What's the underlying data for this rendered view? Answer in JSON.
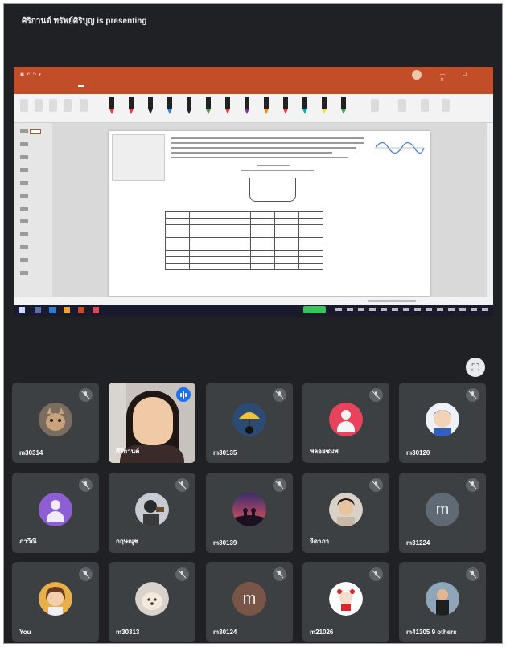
{
  "meeting": {
    "presenter_banner": "ศิริกานต์ ทรัพย์ศิริบุญ is presenting"
  },
  "shared_screen": {
    "app": "PowerPoint",
    "ribbon_tab_active": "Draw"
  },
  "colors": {
    "meet_bg": "#202124",
    "tile_bg": "#3c4043",
    "ppt_accent": "#c24d29",
    "speaking_badge": "#1a73e8"
  },
  "icons": {
    "fullscreen": "fullscreen-icon",
    "mute": "mic-off-icon",
    "speaking": "audio-wave-icon"
  },
  "participants": [
    {
      "name": "m30314",
      "avatar": "photo",
      "muted": true
    },
    {
      "name": "ศิริกานต์",
      "avatar": "video",
      "muted": false,
      "speaking": true
    },
    {
      "name": "m30135",
      "avatar": "photo",
      "muted": true
    },
    {
      "name": "พลอยชมพ",
      "avatar": "default-red",
      "muted": true
    },
    {
      "name": "m30120",
      "avatar": "photo",
      "muted": true
    },
    {
      "name": "ภาวีณี",
      "avatar": "default-purple",
      "muted": true
    },
    {
      "name": "กฤษณุช",
      "avatar": "photo",
      "muted": true
    },
    {
      "name": "m30139",
      "avatar": "photo",
      "muted": true
    },
    {
      "name": "จิดาภา",
      "avatar": "photo",
      "muted": true
    },
    {
      "name": "m31224",
      "avatar": "letter",
      "letter": "m",
      "muted": true
    },
    {
      "name": "You",
      "avatar": "photo",
      "muted": true
    },
    {
      "name": "m30313",
      "avatar": "photo",
      "muted": true
    },
    {
      "name": "m30124",
      "avatar": "letter",
      "letter": "m",
      "muted": true
    },
    {
      "name": "m21026",
      "avatar": "photo",
      "muted": true
    },
    {
      "name": "m41305",
      "avatar": "photo",
      "muted": true,
      "others_label": "9 others"
    }
  ]
}
